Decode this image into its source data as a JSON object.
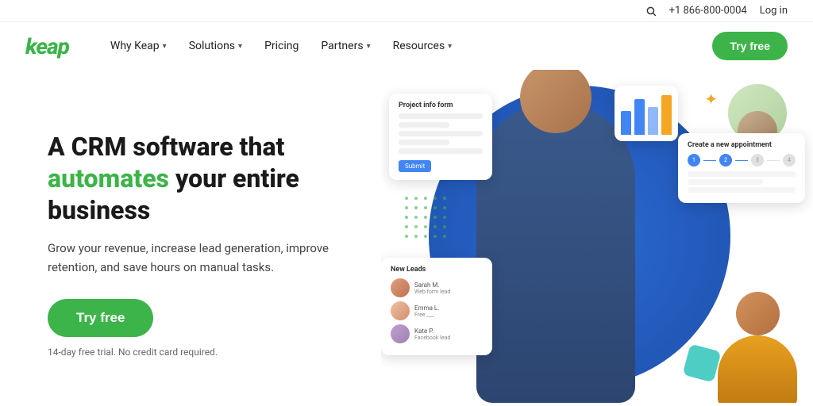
{
  "utility_bar": {
    "phone": "+1 866-800-0004",
    "login_label": "Log in",
    "search_aria": "Search"
  },
  "navbar": {
    "logo": "keap",
    "nav_items": [
      {
        "label": "Why Keap",
        "has_dropdown": true
      },
      {
        "label": "Solutions",
        "has_dropdown": true
      },
      {
        "label": "Pricing",
        "has_dropdown": false
      },
      {
        "label": "Partners",
        "has_dropdown": true
      },
      {
        "label": "Resources",
        "has_dropdown": true
      }
    ],
    "cta_label": "Try free"
  },
  "hero": {
    "heading_part1": "A CRM software that",
    "heading_accent": "automates",
    "heading_part2": "your entire business",
    "subtext": "Grow your revenue, increase lead generation, improve retention, and save hours on manual tasks.",
    "cta_label": "Try free",
    "trial_note": "14-day free trial. No credit card required.",
    "cards": {
      "form_title": "Project info form",
      "leads_title": "New Leads",
      "lead_items": [
        {
          "label": "Web form lead"
        },
        {
          "label": "Free ___"
        },
        {
          "label": "Facebook lead"
        }
      ],
      "appointment_title": "Create a new appointment"
    }
  },
  "colors": {
    "brand_green": "#3cb449",
    "brand_blue": "#2b6bd4",
    "accent_yellow": "#f5a623",
    "accent_teal": "#4ecdc4"
  }
}
